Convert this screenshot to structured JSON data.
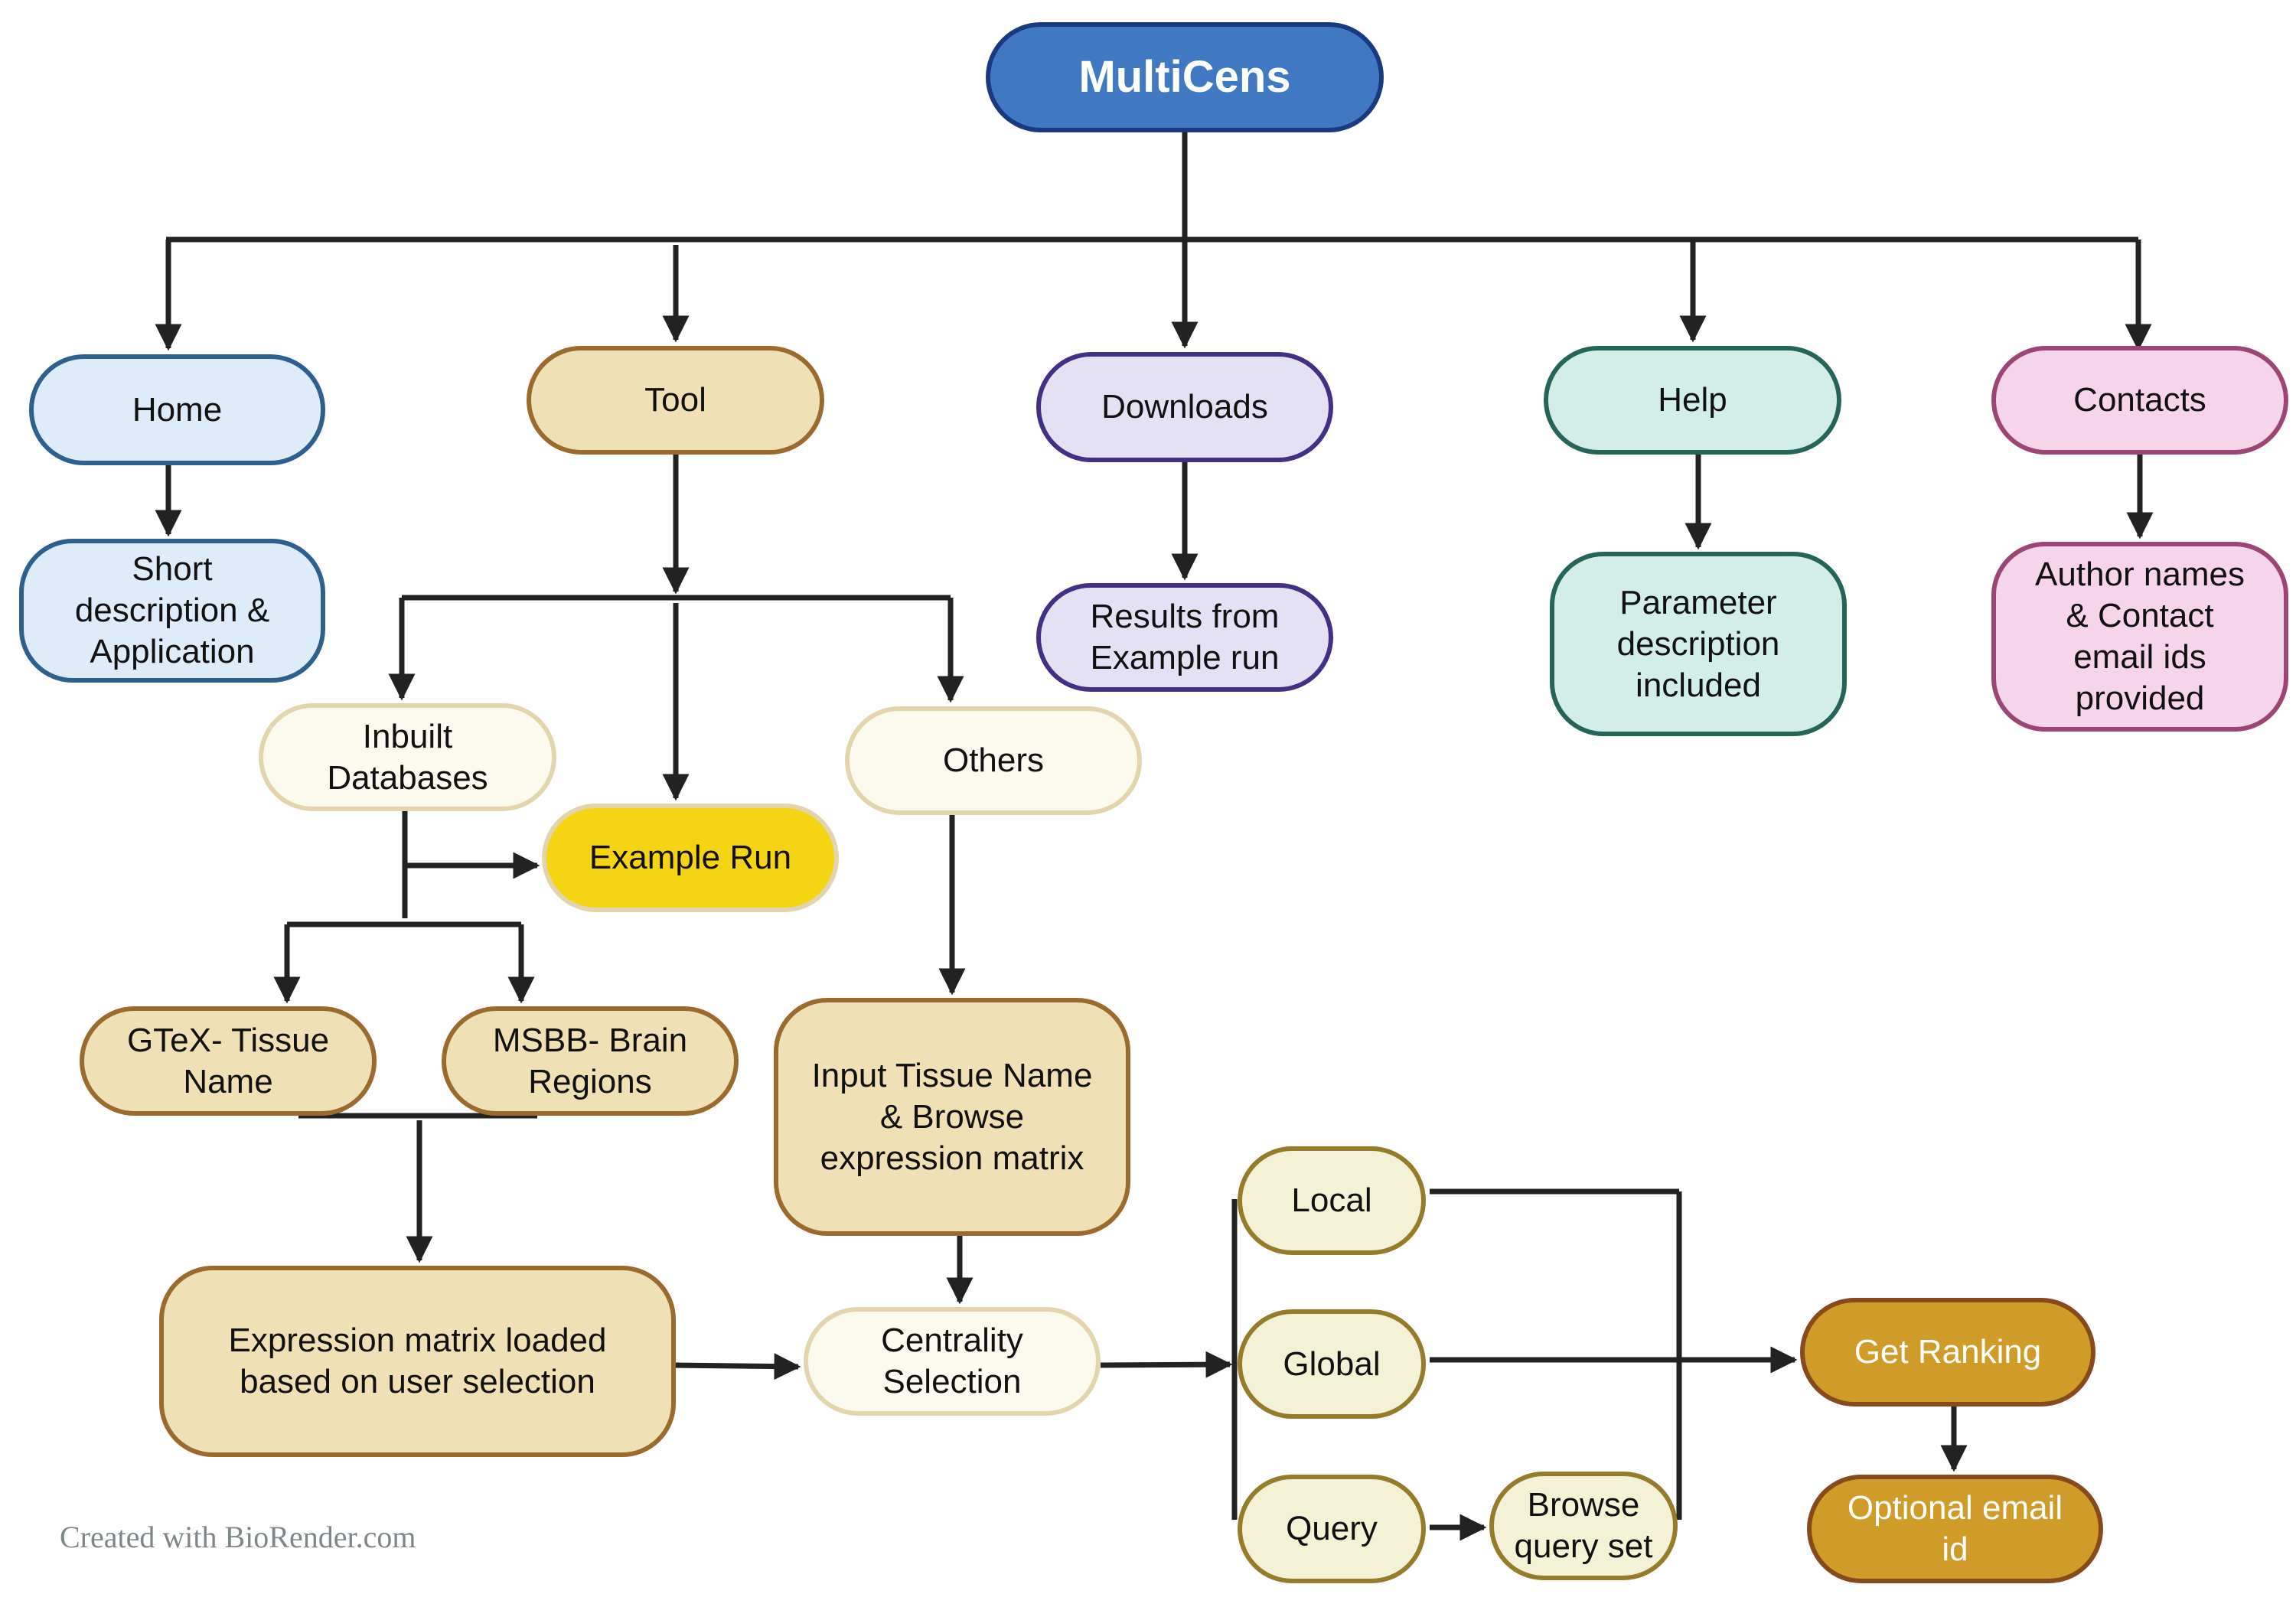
{
  "title": "MultiCens",
  "colors": {
    "root_fill": "#4178c2",
    "root_border": "#1a3a80",
    "home_fill": "#deebf8",
    "home_border": "#2f5f8c",
    "tool_fill": "#f0e0b6",
    "tool_border": "#9a6a2e",
    "downloads_fill": "#e4e1f5",
    "downloads_border": "#433085",
    "help_fill": "#d3ede8",
    "help_border": "#266459",
    "contacts_fill": "#f6d5ea",
    "contacts_border": "#9b4674",
    "option_fill": "#fcf9ee",
    "option_border": "#e2d5ad",
    "example_fill": "#f5d413",
    "centrality_opt_fill": "#f4f2d6",
    "centrality_opt_border": "#957c2b",
    "ranking_fill": "#cf9c2a",
    "ranking_border": "#864b1c",
    "wire": "#222222"
  },
  "nav": {
    "home": "Home",
    "tool": "Tool",
    "downloads": "Downloads",
    "help": "Help",
    "contacts": "Contacts"
  },
  "details": {
    "home": "Short\ndescription &\nApplication",
    "downloads": "Results from\nExample run",
    "help": "Parameter\ndescription\nincluded",
    "contacts": "Author names\n& Contact\nemail ids\nprovided"
  },
  "tool_flow": {
    "inbuilt": "Inbuilt\nDatabases",
    "example_run": "Example Run",
    "others": "Others",
    "gtex": "GTeX- Tissue\nName",
    "msbb": "MSBB- Brain\nRegions",
    "expression_loaded": "Expression matrix loaded\nbased on user selection",
    "input_tissue": "Input Tissue Name\n& Browse\nexpression matrix",
    "centrality": "Centrality\nSelection",
    "local": "Local",
    "global": "Global",
    "query": "Query",
    "browse_query": "Browse\nquery set",
    "get_ranking": "Get Ranking",
    "optional_email": "Optional email\nid"
  },
  "watermark": "Created with BioRender.com"
}
